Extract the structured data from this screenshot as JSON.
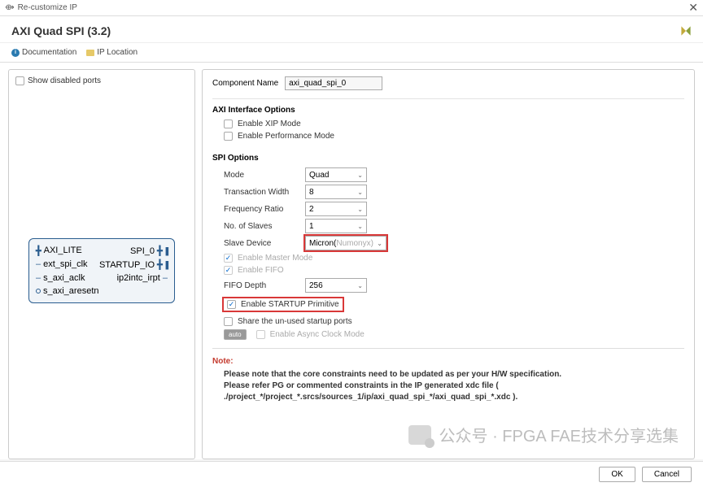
{
  "window": {
    "title": "Re-customize IP"
  },
  "header": {
    "title": "AXI Quad SPI (3.2)"
  },
  "toolbar": {
    "documentation": "Documentation",
    "ip_location": "IP Location"
  },
  "left": {
    "show_disabled": "Show disabled ports",
    "ports": {
      "axi_lite": "AXI_LITE",
      "ext_spi_clk": "ext_spi_clk",
      "s_axi_aclk": "s_axi_aclk",
      "s_axi_aresetn": "s_axi_aresetn",
      "spi_0": "SPI_0",
      "startup_io": "STARTUP_IO",
      "ip2intc_irpt": "ip2intc_irpt"
    }
  },
  "right": {
    "comp_name_label": "Component Name",
    "comp_name_value": "axi_quad_spi_0",
    "axi_section": "AXI Interface Options",
    "enable_xip": "Enable XIP Mode",
    "enable_perf": "Enable Performance Mode",
    "spi_section": "SPI Options",
    "mode_label": "Mode",
    "mode_value": "Quad",
    "txw_label": "Transaction Width",
    "txw_value": "8",
    "freq_label": "Frequency Ratio",
    "freq_value": "2",
    "nslaves_label": "No. of Slaves",
    "nslaves_value": "1",
    "slave_label": "Slave Device",
    "slave_prefix": "Micron(",
    "slave_suffix": "Numonyx)",
    "enable_master": "Enable Master Mode",
    "enable_fifo": "Enable FIFO",
    "fifo_depth_label": "FIFO Depth",
    "fifo_depth_value": "256",
    "enable_startup": "Enable STARTUP Primitive",
    "share_startup": "Share the un-used startup ports",
    "auto_btn": "auto",
    "enable_async": "Enable Async Clock Mode",
    "note_head": "Note:",
    "note_line1": "Please note that the core constraints need to be updated as per your H/W specification.",
    "note_line2": "Please refer PG or commented constraints in the IP generated xdc file ( ./project_*/project_*.srcs/sources_1/ip/axi_quad_spi_*/axi_quad_spi_*.xdc )."
  },
  "footer": {
    "ok": "OK",
    "cancel": "Cancel"
  },
  "watermark": "公众号 · FPGA FAE技术分享选集"
}
